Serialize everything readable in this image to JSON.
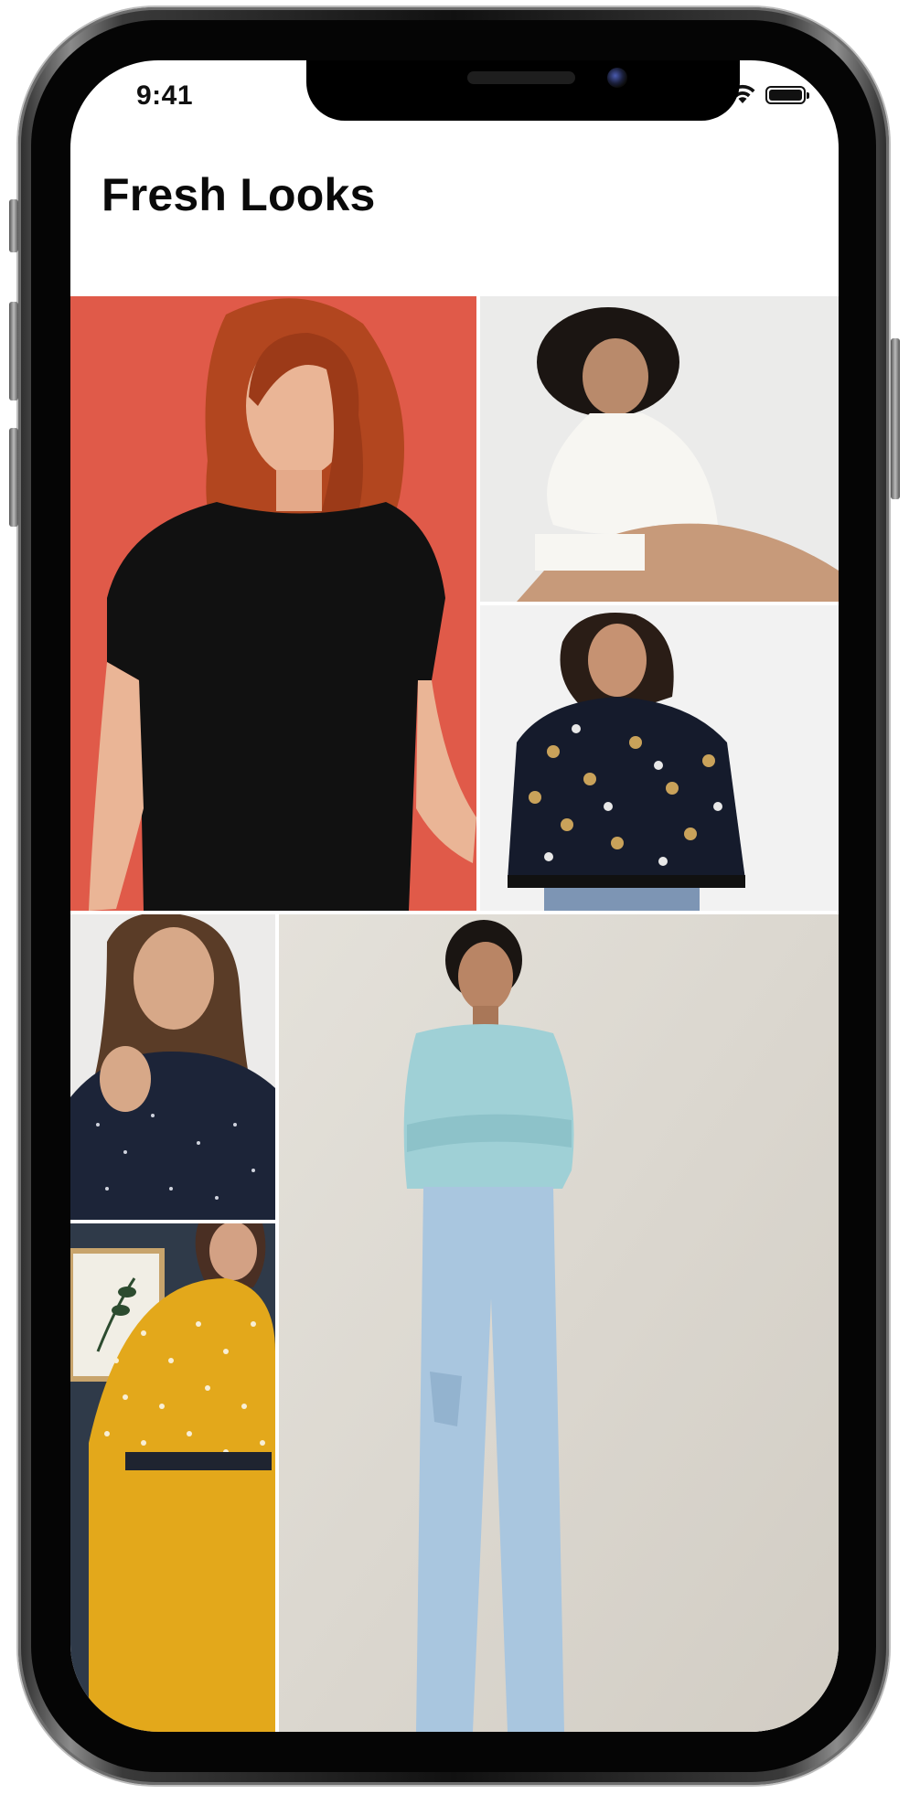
{
  "status_bar": {
    "time": "9:41",
    "icons": [
      "signal-icon",
      "wifi-icon",
      "battery-icon"
    ]
  },
  "header": {
    "title": "Fresh Looks"
  },
  "gallery": {
    "items": [
      {
        "name": "look-black-tee",
        "background": "#e05a49",
        "garment": "#111111"
      },
      {
        "name": "look-white-turtleneck",
        "background": "#ebebea",
        "garment": "#f7f6f2"
      },
      {
        "name": "look-printed-bomber",
        "background": "#f2f2f2",
        "garment": "#151b2c"
      },
      {
        "name": "look-navy-dot-shirt",
        "background": "#ecebea",
        "garment": "#1c2438"
      },
      {
        "name": "look-blue-sweater",
        "background": "#dedad3",
        "garment": "#9fd0d6"
      },
      {
        "name": "look-yellow-dot-blouse",
        "background": "#2f3a49",
        "garment": "#e3a81b"
      }
    ]
  },
  "colors": {
    "screen_background": "#ffffff",
    "title_text": "#0a0a0a",
    "device_frame": "#111111"
  }
}
